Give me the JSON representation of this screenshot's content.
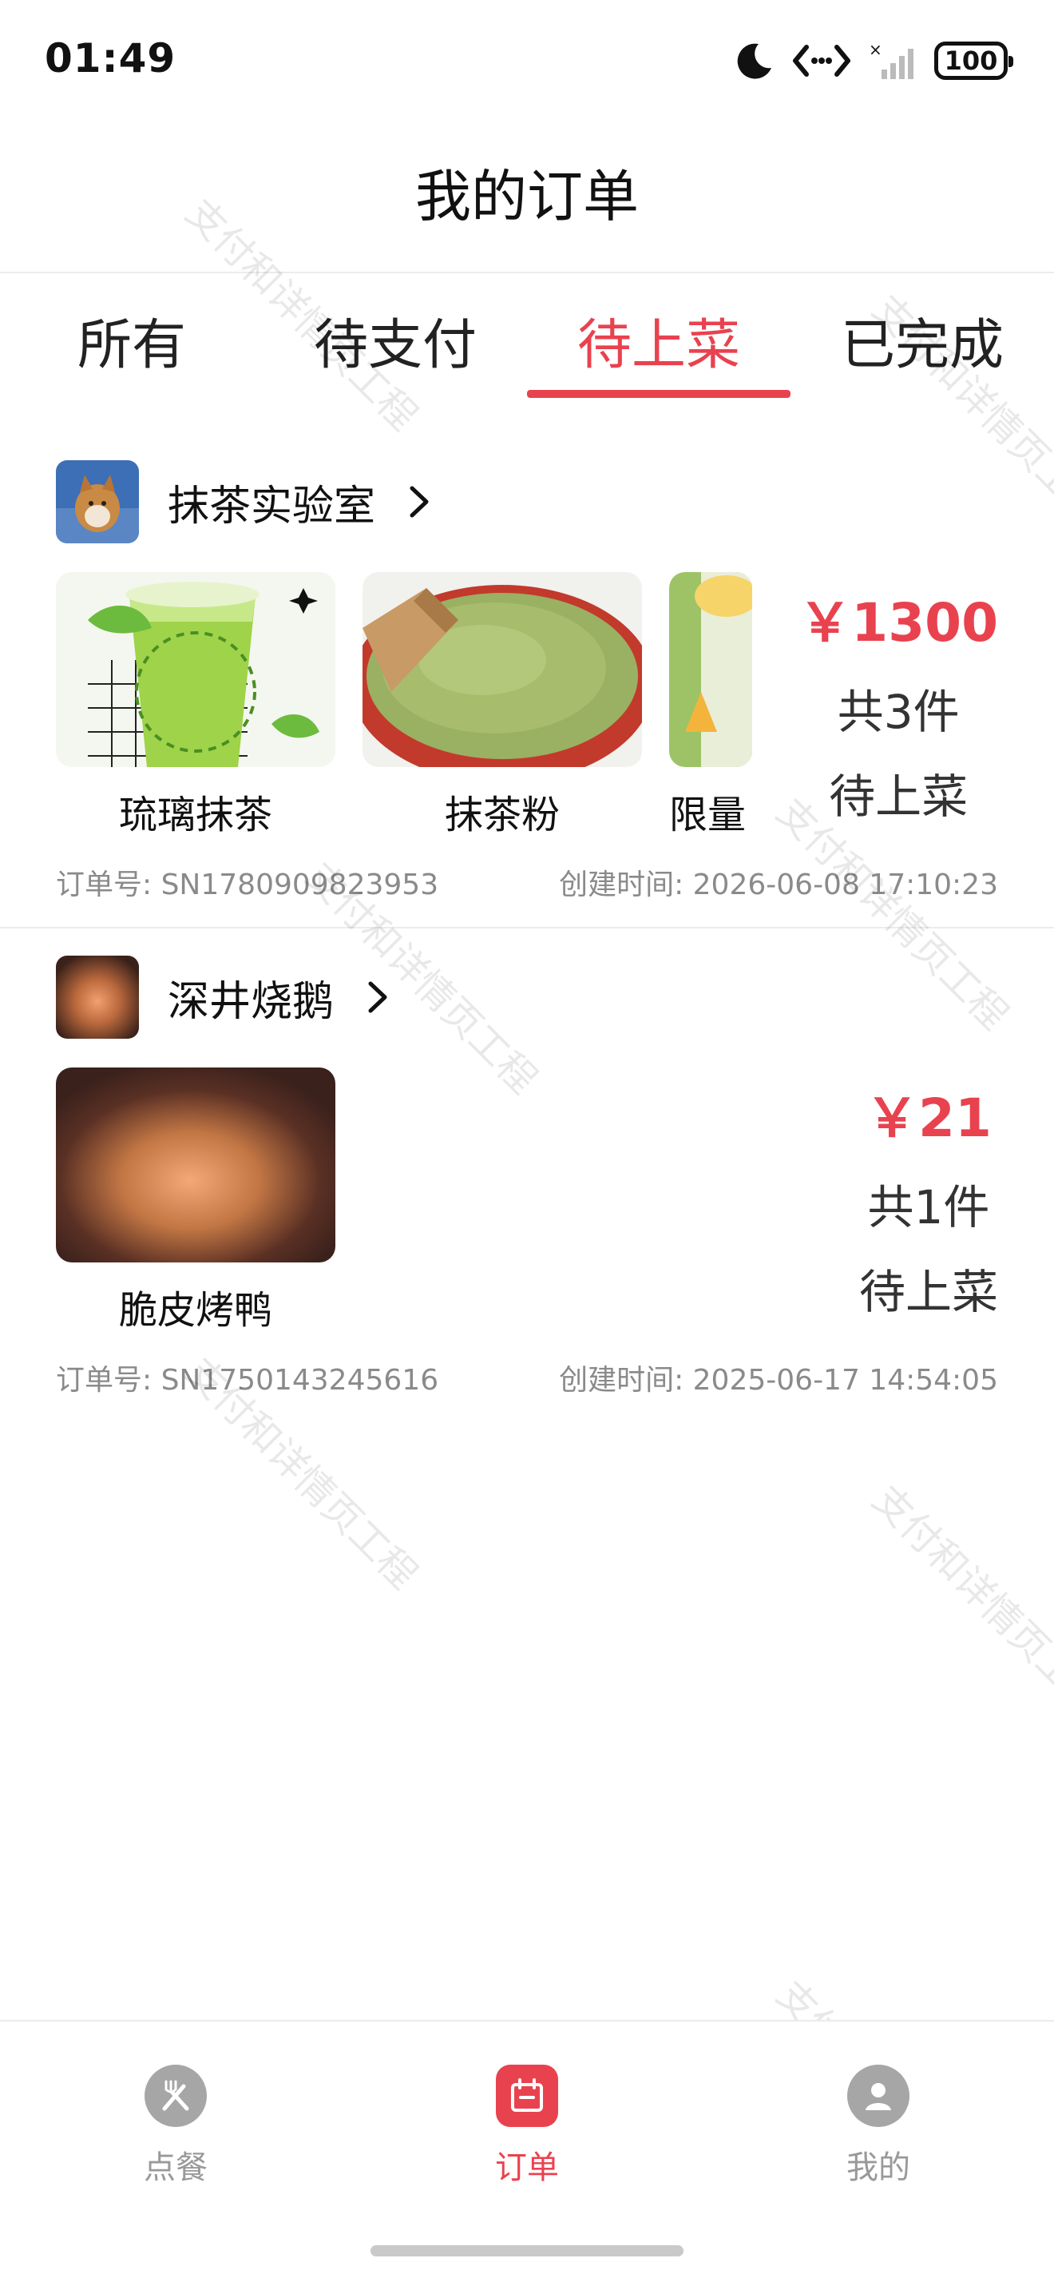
{
  "status_bar": {
    "time": "01:49",
    "battery": "100"
  },
  "header": {
    "title": "我的订单"
  },
  "tabs": [
    {
      "label": "所有",
      "active": false
    },
    {
      "label": "待支付",
      "active": false
    },
    {
      "label": "待上菜",
      "active": true
    },
    {
      "label": "已完成",
      "active": false
    }
  ],
  "orders": [
    {
      "shop_name": "抹茶实验室",
      "items": [
        {
          "name": "琉璃抹茶"
        },
        {
          "name": "抹茶粉"
        },
        {
          "name": "限量"
        }
      ],
      "price": "￥1300",
      "count": "共3件",
      "status": "待上菜",
      "order_no": "订单号: SN1780909823953",
      "created": "创建时间:  2026-06-08 17:10:23"
    },
    {
      "shop_name": "深井烧鹅",
      "items": [
        {
          "name": "脆皮烤鸭"
        }
      ],
      "price": "￥21",
      "count": "共1件",
      "status": "待上菜",
      "order_no": "订单号: SN1750143245616",
      "created": "创建时间:  2025-06-17 14:54:05"
    }
  ],
  "bottom_nav": [
    {
      "label": "点餐",
      "icon": "fork-knife-icon",
      "active": false
    },
    {
      "label": "订单",
      "icon": "calendar-icon",
      "active": true
    },
    {
      "label": "我的",
      "icon": "user-icon",
      "active": false
    }
  ],
  "watermark": "支付和详情页工程",
  "colors": {
    "accent": "#e9424f",
    "muted": "#8a8a8a",
    "divider": "#ececec"
  }
}
